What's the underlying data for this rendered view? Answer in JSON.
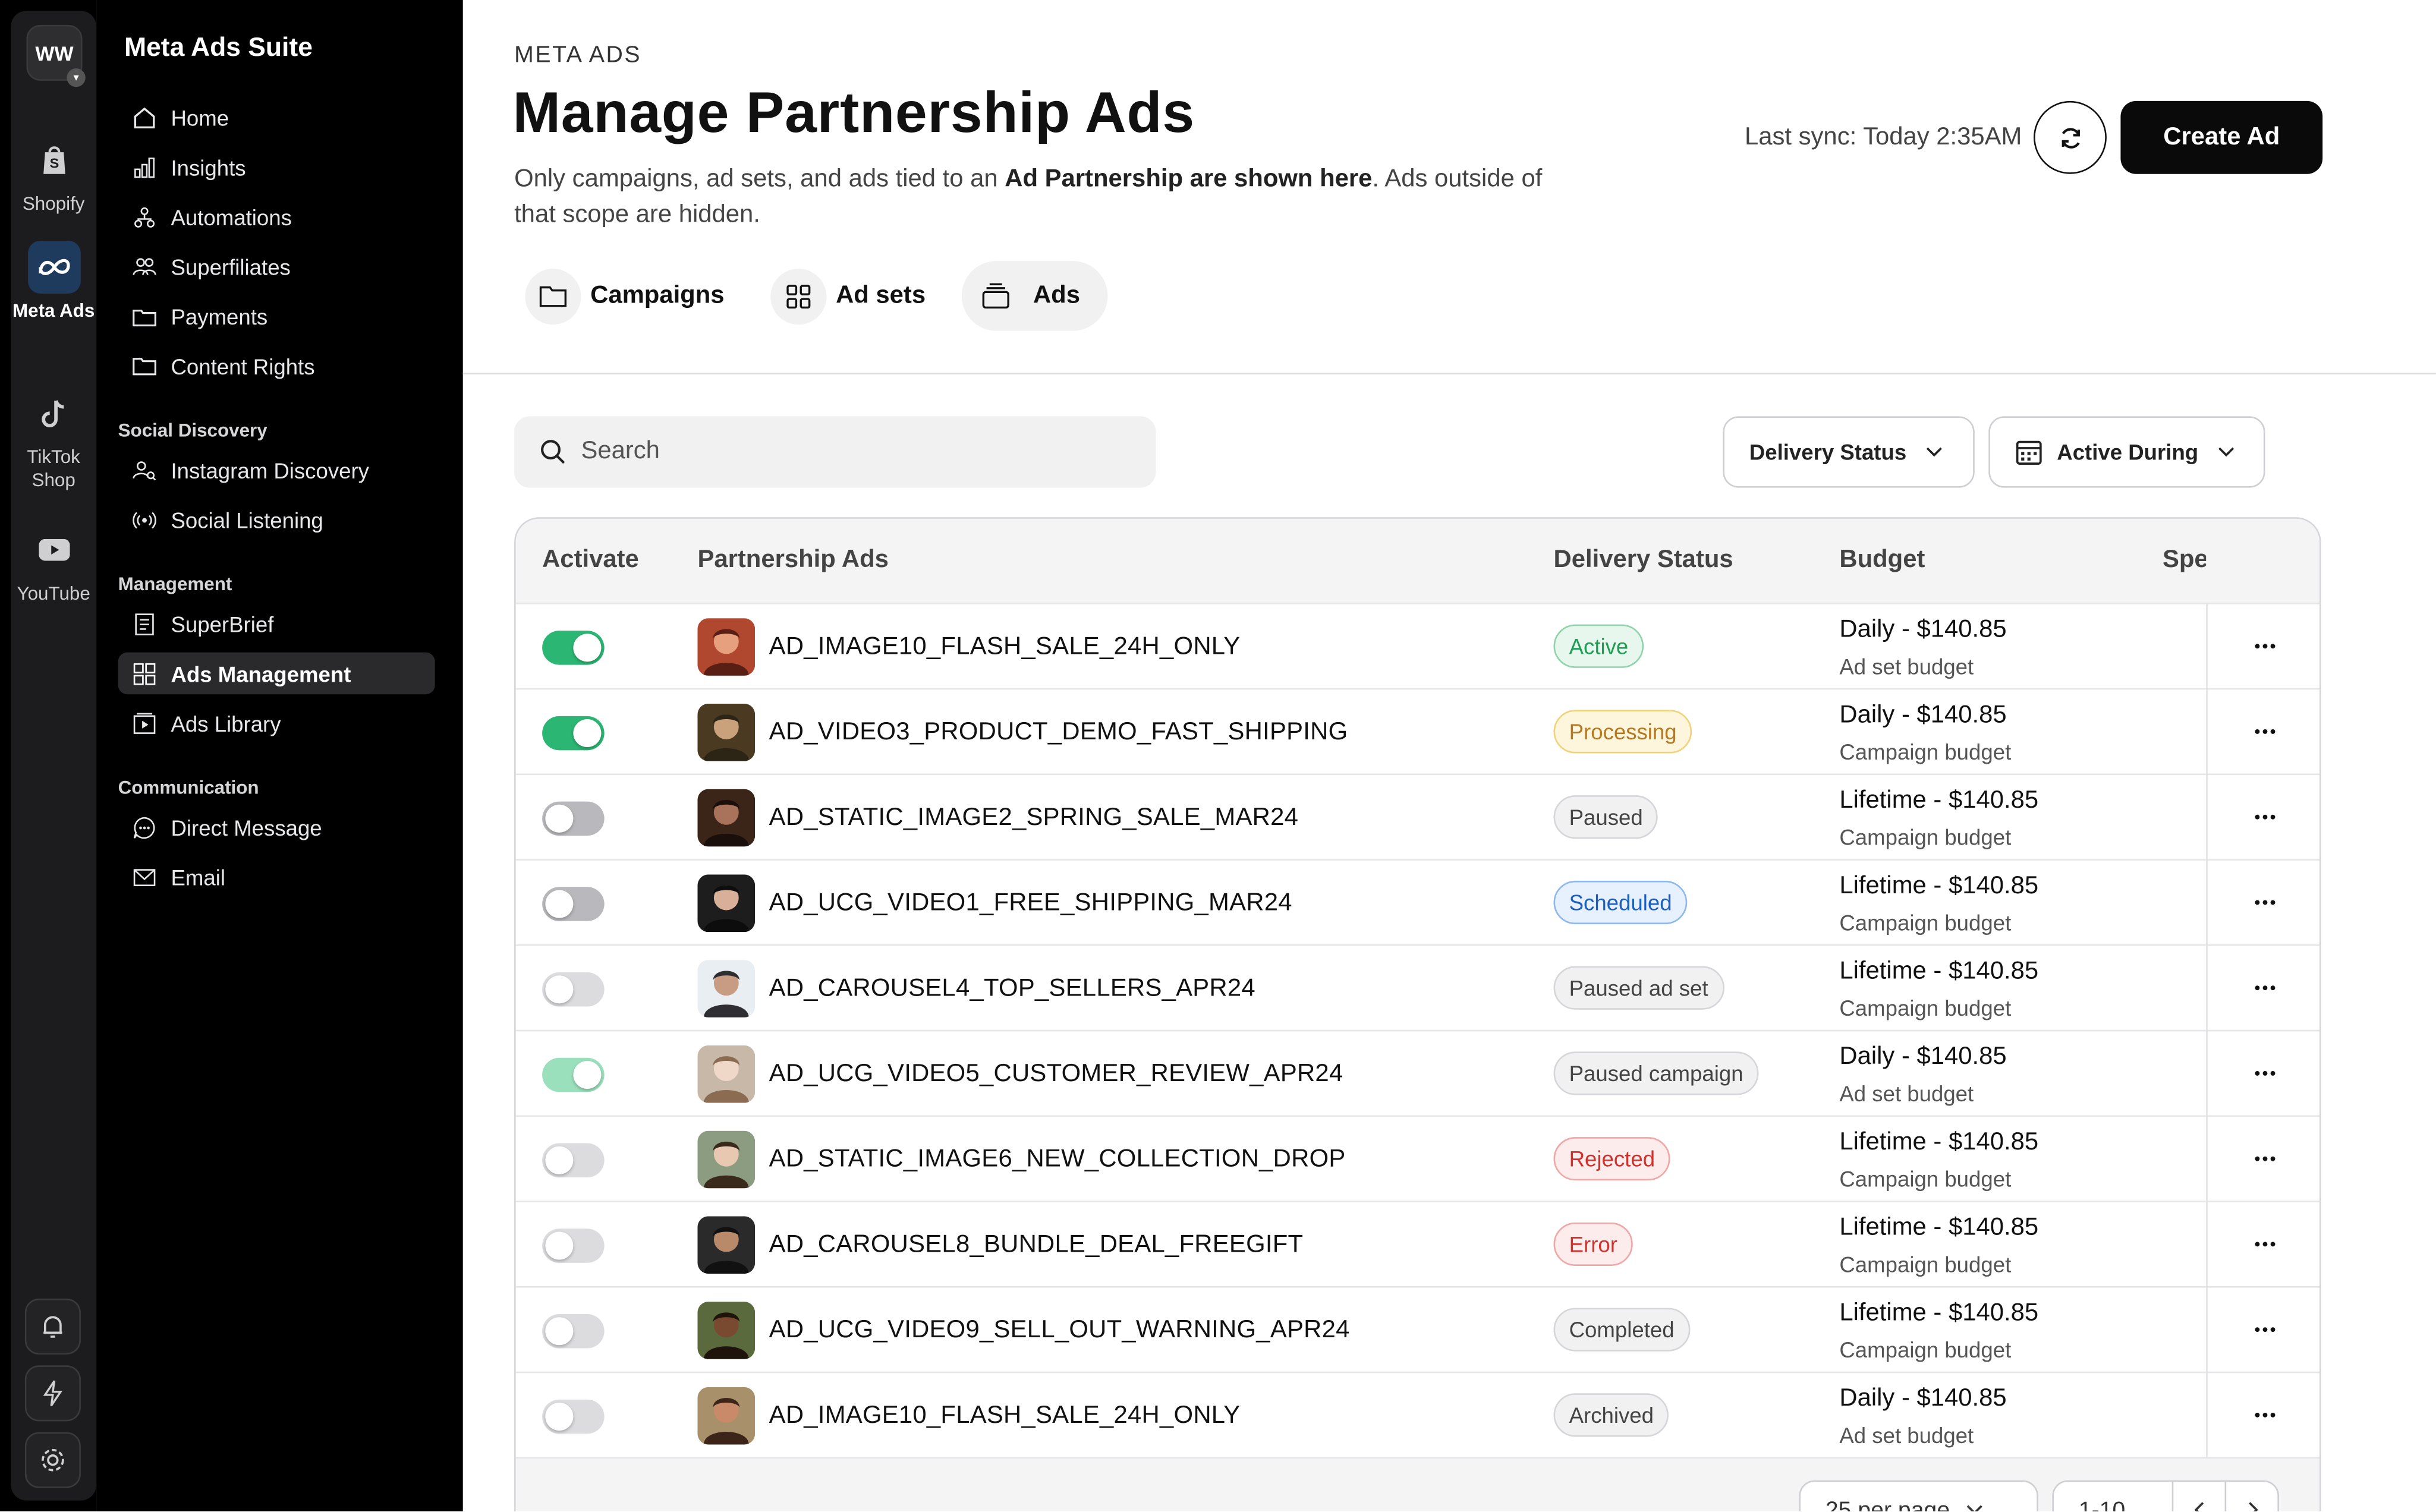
{
  "workspace": {
    "initials": "WW"
  },
  "rail": [
    {
      "label": "Shopify",
      "icon": "shopify-icon"
    },
    {
      "label": "Meta Ads",
      "icon": "meta-icon",
      "active": true
    },
    {
      "label": "TikTok Shop",
      "icon": "tiktok-icon"
    },
    {
      "label": "YouTube",
      "icon": "youtube-icon"
    }
  ],
  "sidebar": {
    "title": "Meta Ads Suite",
    "items": [
      {
        "label": "Home"
      },
      {
        "label": "Insights"
      },
      {
        "label": "Automations"
      },
      {
        "label": "Superfiliates"
      },
      {
        "label": "Payments"
      },
      {
        "label": "Content Rights"
      }
    ],
    "section_social": "Social Discovery",
    "social_items": [
      {
        "label": "Instagram Discovery"
      },
      {
        "label": "Social Listening"
      }
    ],
    "section_management": "Management",
    "management_items": [
      {
        "label": "SuperBrief"
      },
      {
        "label": "Ads Management",
        "active": true
      },
      {
        "label": "Ads Library"
      }
    ],
    "section_communication": "Communication",
    "communication_items": [
      {
        "label": "Direct Message"
      },
      {
        "label": "Email"
      }
    ]
  },
  "header": {
    "eyebrow": "META ADS",
    "title": "Manage Partnership Ads",
    "subtitle_pre": "Only campaigns, ad sets, and ads tied to an ",
    "subtitle_bold": "Ad Partnership are shown here",
    "subtitle_post": ". Ads outside of that scope are hidden.",
    "last_sync": "Last sync: Today 2:35AM",
    "create_label": "Create Ad"
  },
  "tabs": [
    {
      "label": "Campaigns"
    },
    {
      "label": "Ad sets"
    },
    {
      "label": "Ads",
      "active": true
    }
  ],
  "filters": {
    "search_placeholder": "Search",
    "delivery_status": "Delivery Status",
    "active_during": "Active During"
  },
  "table": {
    "columns": [
      "Activate",
      "Partnership Ads",
      "Delivery Status",
      "Budget",
      "Spe"
    ],
    "rows": [
      {
        "toggle": "on",
        "name": "AD_IMAGE10_FLASH_SALE_24H_ONLY",
        "status": "Active",
        "budget": "Daily - $140.85",
        "budget_type": "Ad set budget"
      },
      {
        "toggle": "on",
        "name": "AD_VIDEO3_PRODUCT_DEMO_FAST_SHIPPING",
        "status": "Processing",
        "budget": "Daily - $140.85",
        "budget_type": "Campaign budget"
      },
      {
        "toggle": "off-dark",
        "name": "AD_STATIC_IMAGE2_SPRING_SALE_MAR24",
        "status": "Paused",
        "budget": "Lifetime - $140.85",
        "budget_type": "Campaign budget"
      },
      {
        "toggle": "off-dark",
        "name": "AD_UCG_VIDEO1_FREE_SHIPPING_MAR24",
        "status": "Scheduled",
        "budget": "Lifetime - $140.85",
        "budget_type": "Campaign budget"
      },
      {
        "toggle": "off",
        "name": "AD_CAROUSEL4_TOP_SELLERS_APR24",
        "status": "Paused ad set",
        "budget": "Lifetime - $140.85",
        "budget_type": "Campaign budget"
      },
      {
        "toggle": "on-dim",
        "name": "AD_UCG_VIDEO5_CUSTOMER_REVIEW_APR24",
        "status": "Paused campaign",
        "budget": "Daily - $140.85",
        "budget_type": "Ad set budget"
      },
      {
        "toggle": "off",
        "name": "AD_STATIC_IMAGE6_NEW_COLLECTION_DROP",
        "status": "Rejected",
        "budget": "Lifetime - $140.85",
        "budget_type": "Campaign budget"
      },
      {
        "toggle": "off",
        "name": "AD_CAROUSEL8_BUNDLE_DEAL_FREEGIFT",
        "status": "Error",
        "budget": "Lifetime - $140.85",
        "budget_type": "Campaign budget"
      },
      {
        "toggle": "off",
        "name": "AD_UCG_VIDEO9_SELL_OUT_WARNING_APR24",
        "status": "Completed",
        "budget": "Lifetime - $140.85",
        "budget_type": "Campaign budget"
      },
      {
        "toggle": "off",
        "name": "AD_IMAGE10_FLASH_SALE_24H_ONLY",
        "status": "Archived",
        "budget": "Daily - $140.85",
        "budget_type": "Ad set budget"
      }
    ]
  },
  "pagination": {
    "per_page": "25 per page",
    "range": "1-10"
  },
  "colors": {
    "accent_green": "#2bb673",
    "status_active": "#1f9d55",
    "status_processing": "#b7791f",
    "status_scheduled": "#1d5fbf",
    "status_error": "#d0312d"
  }
}
